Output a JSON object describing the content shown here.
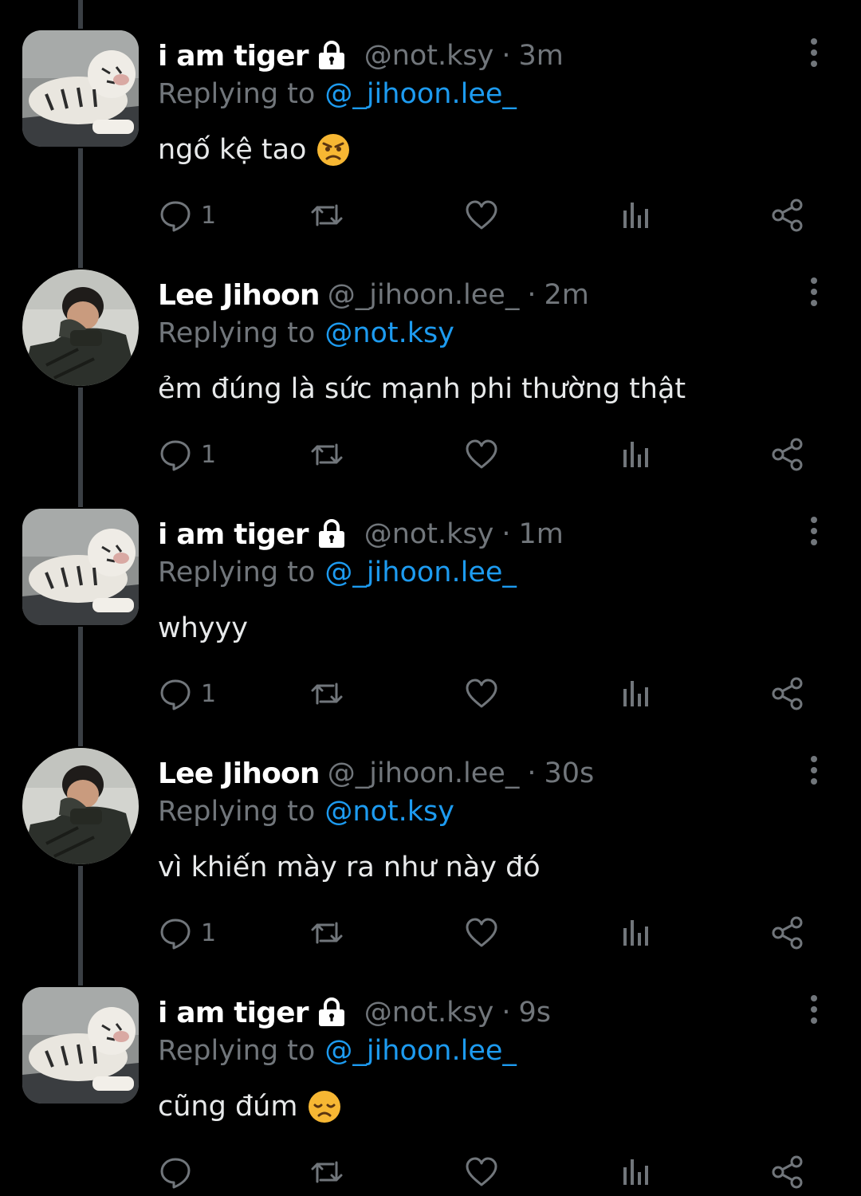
{
  "replying_label": "Replying to",
  "tweets": [
    {
      "display_name": "i am tiger",
      "protected": true,
      "handle": "@not.ksy",
      "separator": "·",
      "time": "3m",
      "replying_to": "@_jihoon.lee_",
      "text": "ngố kệ tao",
      "emoji": "angry-face",
      "reply_count": "1",
      "avatar": "white-tiger"
    },
    {
      "display_name": "Lee Jihoon",
      "protected": false,
      "handle": "@_jihoon.lee_",
      "separator": "·",
      "time": "2m",
      "replying_to": "@not.ksy",
      "text": "ẻm đúng là sức mạnh phi thường thật",
      "emoji": "",
      "reply_count": "1",
      "avatar": "person-photo"
    },
    {
      "display_name": "i am tiger",
      "protected": true,
      "handle": "@not.ksy",
      "separator": "·",
      "time": "1m",
      "replying_to": "@_jihoon.lee_",
      "text": "whyyy",
      "emoji": "",
      "reply_count": "1",
      "avatar": "white-tiger"
    },
    {
      "display_name": "Lee Jihoon",
      "protected": false,
      "handle": "@_jihoon.lee_",
      "separator": "·",
      "time": "30s",
      "replying_to": "@not.ksy",
      "text": "vì khiến mày ra như này đó",
      "emoji": "",
      "reply_count": "1",
      "avatar": "person-photo"
    },
    {
      "display_name": "i am tiger",
      "protected": true,
      "handle": "@not.ksy",
      "separator": "·",
      "time": "9s",
      "replying_to": "@_jihoon.lee_",
      "text": "cũng đúm",
      "emoji": "disappointed-face",
      "reply_count": "",
      "avatar": "white-tiger"
    }
  ],
  "colors": {
    "background": "#000000",
    "primary_text": "#e7e9ea",
    "secondary_text": "#71767b",
    "accent": "#1d9bf0",
    "thread_line": "#3a3f44"
  },
  "icons": {
    "protected": "lock-icon",
    "more": "more-vertical-icon",
    "reply": "reply-icon",
    "retweet": "retweet-icon",
    "like": "heart-icon",
    "views": "views-icon",
    "share": "share-icon"
  }
}
